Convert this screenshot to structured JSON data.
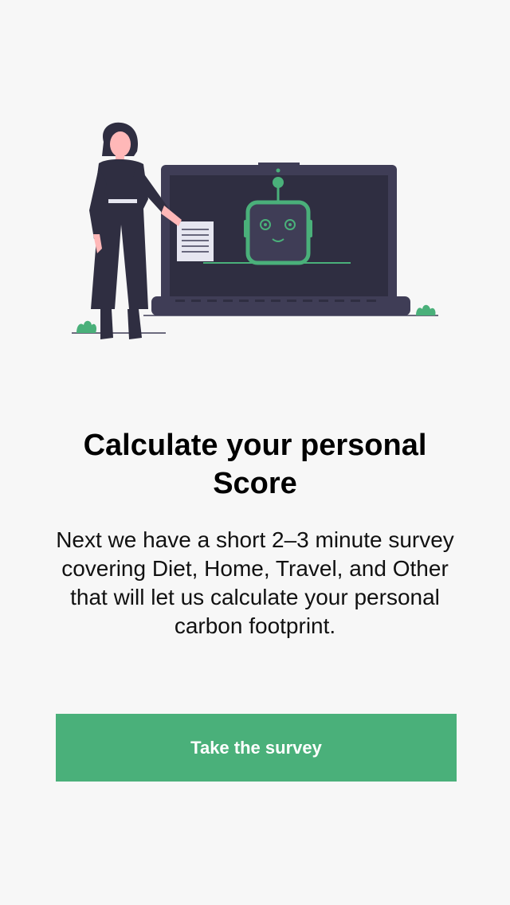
{
  "colors": {
    "background": "#f7f7f7",
    "accent": "#4ab07a",
    "illustration_dark": "#3f3d56",
    "illustration_screen": "#2f2e41"
  },
  "illustration": {
    "icon": "woman-presenting-laptop-robot-illustration"
  },
  "intro": {
    "title": "Calculate your personal Score",
    "description": "Next we have a short 2–3 minute survey covering Diet, Home, Travel, and Other that will let us calculate your personal carbon footprint."
  },
  "actions": {
    "primary_label": "Take the survey"
  }
}
